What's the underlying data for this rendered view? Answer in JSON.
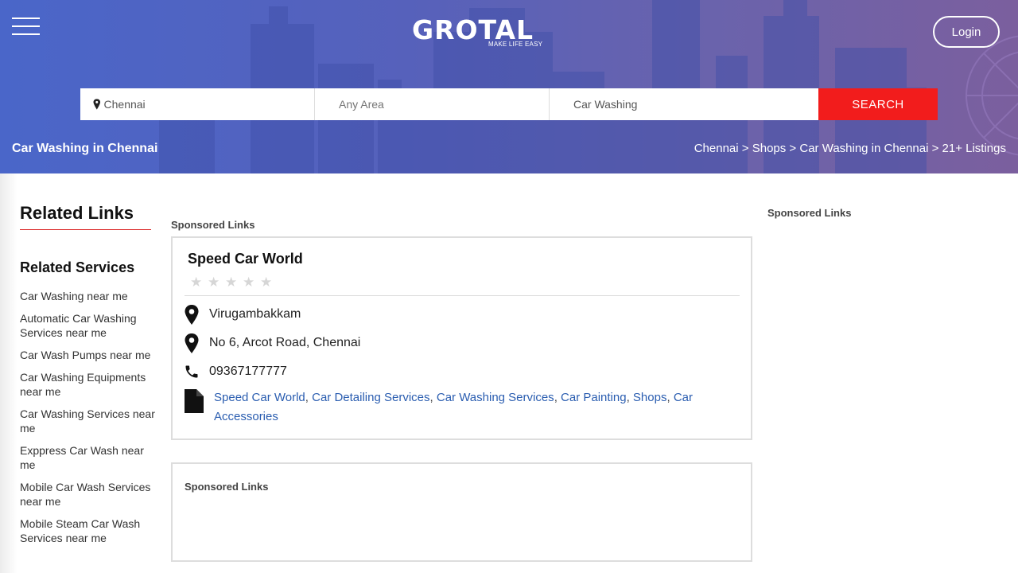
{
  "header": {
    "logo_text": "GROTAL",
    "logo_tagline": "MAKE LIFE EASY",
    "login_label": "Login"
  },
  "search": {
    "city_value": "Chennai",
    "area_placeholder": "Any Area",
    "category_value": "Car Washing",
    "button_label": "SEARCH"
  },
  "hero": {
    "title": "Car Washing in Chennai",
    "breadcrumb": {
      "items": [
        "Chennai",
        "Shops",
        "Car Washing in Chennai"
      ],
      "separator": " > ",
      "count": "21+ Listings"
    }
  },
  "sidebar": {
    "related_links_title": "Related Links",
    "related_services_title": "Related Services",
    "services": [
      "Car Washing near me",
      "Automatic Car Washing Services near me",
      "Car Wash Pumps near me",
      "Car Washing Equipments near me",
      "Car Washing Services near me",
      "Exppress Car Wash near me",
      "Mobile Car Wash Services near me",
      "Mobile Steam Car Wash Services near me"
    ]
  },
  "main": {
    "sponsored_label": "Sponsored Links",
    "listing": {
      "name": "Speed Car World",
      "rating": 0,
      "locality": "Virugambakkam",
      "address": "No 6, Arcot Road, Chennai",
      "phone": "09367177777",
      "tags": [
        "Speed Car World",
        "Car Detailing Services",
        "Car Washing Services",
        "Car Painting",
        "Shops",
        "Car Accessories"
      ]
    },
    "sponsored_box_label": "Sponsored Links"
  },
  "right": {
    "sponsored_label": "Sponsored Links"
  },
  "colors": {
    "accent": "#f21c1c",
    "link": "#2a5db0",
    "hero_start": "#4a66c9",
    "hero_end": "#7b5f9e"
  }
}
